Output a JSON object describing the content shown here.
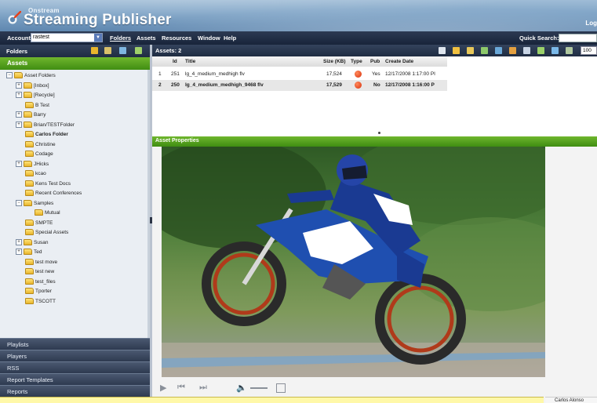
{
  "header": {
    "logo_small": "Onstream",
    "logo_big": "Streaming Publisher",
    "logout": "Log"
  },
  "menubar": {
    "account_label": "Account:",
    "account_value": "rastest",
    "menus": [
      "Folders",
      "Assets",
      "Resources",
      "Window",
      "Help"
    ],
    "quick_search_label": "Quick Search:",
    "quick_search_value": ""
  },
  "left": {
    "folders_title": "Folders",
    "assets_title": "Assets",
    "tree": [
      {
        "label": "Asset Folders",
        "pm": "−",
        "indent": 0
      },
      {
        "label": "[Inbox]",
        "pm": "+",
        "indent": 1
      },
      {
        "label": "[Recycle]",
        "pm": "+",
        "indent": 1
      },
      {
        "label": "B Test",
        "pm": "",
        "indent": 2
      },
      {
        "label": "Barry",
        "pm": "+",
        "indent": 1
      },
      {
        "label": "Brian/TESTFolder",
        "pm": "+",
        "indent": 1
      },
      {
        "label": "Carlos Folder",
        "pm": "",
        "indent": 2,
        "bold": true
      },
      {
        "label": "Christine",
        "pm": "",
        "indent": 2
      },
      {
        "label": "Codage",
        "pm": "",
        "indent": 2
      },
      {
        "label": "JHicks",
        "pm": "+",
        "indent": 1
      },
      {
        "label": "kcao",
        "pm": "",
        "indent": 2
      },
      {
        "label": "Kens Test Docs",
        "pm": "",
        "indent": 2
      },
      {
        "label": "Recent Conferences",
        "pm": "",
        "indent": 2
      },
      {
        "label": "Samples",
        "pm": "−",
        "indent": 1
      },
      {
        "label": "Mutual",
        "pm": "",
        "indent": 3
      },
      {
        "label": "SMPTE",
        "pm": "",
        "indent": 2
      },
      {
        "label": "Special Assets",
        "pm": "",
        "indent": 2
      },
      {
        "label": "Susan",
        "pm": "+",
        "indent": 1
      },
      {
        "label": "Ted",
        "pm": "+",
        "indent": 1
      },
      {
        "label": "test move",
        "pm": "",
        "indent": 2
      },
      {
        "label": "test new",
        "pm": "",
        "indent": 2
      },
      {
        "label": "test_files",
        "pm": "",
        "indent": 2
      },
      {
        "label": "Tporter",
        "pm": "",
        "indent": 2
      },
      {
        "label": "TSCOTT",
        "pm": "",
        "indent": 2
      }
    ],
    "accordion": [
      "Playlists",
      "Players",
      "RSS",
      "Report Templates",
      "Reports"
    ]
  },
  "assets_list": {
    "title": "Assets: 2",
    "page_size": "100",
    "columns": {
      "id": "Id",
      "title": "Title",
      "size": "Size (KB)",
      "type": "Type",
      "pub": "Pub",
      "create_date": "Create Date"
    },
    "rows": [
      {
        "num": "1",
        "id": "251",
        "title": "lg_4_medium_medhigh flv",
        "size": "17,524",
        "pub": "Yes",
        "date": "12/17/2008 1:17:00 PI"
      },
      {
        "num": "2",
        "id": "250",
        "title": "lg_4_medium_medhigh_9468 flv",
        "size": "17,529",
        "pub": "No",
        "date": "12/17/2008 1:16:00 P"
      }
    ]
  },
  "properties": {
    "title": "Asset Properties"
  },
  "status": {
    "user": "Carlos Alonso"
  },
  "colors": {
    "green_band": "#4f9c1a",
    "dark_bar": "#24314a",
    "header_blue": "#7ea3c6"
  }
}
